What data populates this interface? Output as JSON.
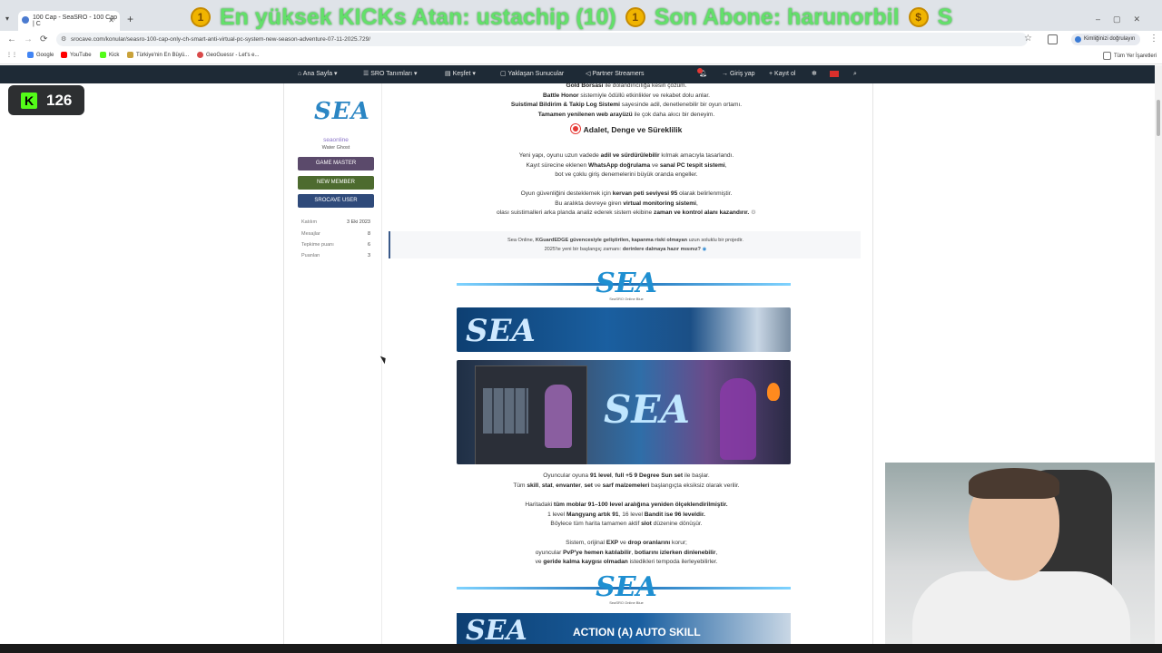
{
  "browser": {
    "tab_title": "100 Cap - SeaSRO - 100 Cap | C",
    "marquee_1": "En yüksek KICKs Atan: ustachip (10)",
    "marquee_2": "Son Abone: harunorbil",
    "marquee_3": "S",
    "url": "srocave.com/konular/seasro-100-cap-only-ch-smart-anti-virtual-pc-system-new-season-adventure-07-11-2025.729/",
    "profile_label": "Kimliğinizi doğrulayın",
    "bookmarks": [
      "Google",
      "YouTube",
      "Kick",
      "Türkiye'nin En Büyü...",
      "GeoGuessr - Let's e..."
    ],
    "all_bookmarks": "Tüm Yer İşaretleri"
  },
  "site_nav": {
    "home": "Ana Sayfa",
    "sro": "SRO Tanımları",
    "explore": "Keşfet",
    "upcoming": "Yaklaşan Sunucular",
    "partners": "Partner Streamers",
    "login": "Giriş yap",
    "register": "Kayıt ol"
  },
  "user_card": {
    "logo": "SEA",
    "username": "seaonline",
    "title": "Water Ghost",
    "badges": [
      "GAME MASTER",
      "NEW MEMBER",
      "SROCAVE USER"
    ],
    "stats": [
      {
        "label": "Katılım",
        "value": "3 Eki 2023"
      },
      {
        "label": "Mesajlar",
        "value": "8"
      },
      {
        "label": "Tepkime puanı",
        "value": "6"
      },
      {
        "label": "Puanları",
        "value": "3"
      }
    ]
  },
  "post": {
    "top_line_1_b": "Gold Borsası",
    "top_line_1": " ile dolandırıcılığa kesin çözüm.",
    "top_line_2_b": "Battle Honor",
    "top_line_2": " sistemiyle ödüllü etkinlikler ve rekabet dolu anlar.",
    "top_line_3_b": "Suistimal Bildirim & Takip Log Sistemi",
    "top_line_3": " sayesinde adil, denetlenebilir bir oyun ortamı.",
    "top_line_4_b": "Tamamen yenilenen web arayüzü",
    "top_line_4": " ile çok daha akıcı bir deneyim.",
    "heading": "Adalet, Denge ve Süreklilik",
    "p1_a": "Yeni yapı, oyunu uzun vadede ",
    "p1_b": "adil ve sürdürülebilir",
    "p1_c": " kılmak amacıyla tasarlandı.",
    "p2_a": "Kayıt sürecine eklenen ",
    "p2_b": "WhatsApp doğrulama",
    "p2_c": " ve ",
    "p2_d": "sanal PC tespit sistemi",
    "p2_e": ",",
    "p3": "bot ve çoklu giriş denemelerini büyük oranda engeller.",
    "p4_a": "Oyun güvenliğini desteklemek için ",
    "p4_b": "kervan peti seviyesi 95",
    "p4_c": " olarak belirlenmiştir.",
    "p5_a": "Bu aralıkta devreye giren ",
    "p5_b": "virtual monitoring sistemi",
    "p5_c": ",",
    "p6_a": "olası suistimalleri arka planda analiz ederek sistem ekibine ",
    "p6_b": "zaman ve kontrol alanı kazandırır.",
    "quote_a": "Sea Online, ",
    "quote_b": "KGuardEDGE güvencesiyle geliştirilen, kapanma riski olmayan",
    "quote_c": " uzun soluklu bir projedir.",
    "quote_d": "2025'te yeni bir başlangıç zamanı: ",
    "quote_e": "derinlere dalmaya hazır mısınız?",
    "banner_logo": "SEA",
    "banner_sub": "SeaSRO Online Blue",
    "p7_a": "Oyuncular oyuna ",
    "p7_b": "91 level",
    "p7_c": ", ",
    "p7_d": "full +5 9 Degree Sun set",
    "p7_e": " ile başlar.",
    "p8_a": "Tüm ",
    "p8_b": "skill",
    "p8_c": ", ",
    "p8_d": "stat",
    "p8_e": ", ",
    "p8_f": "envanter",
    "p8_g": ", ",
    "p8_h": "set",
    "p8_i": " ve ",
    "p8_j": "sarf malzemeleri",
    "p8_k": " başlangıçta eksiksiz olarak verilir.",
    "p9_a": "Haritadaki ",
    "p9_b": "tüm moblar 91–100 level aralığına yeniden ölçeklendirilmiştir.",
    "p10_a": "1 level ",
    "p10_b": "Mangyang artık 91",
    "p10_c": ", 16 level ",
    "p10_d": "Bandit ise 96 leveldir.",
    "p11_a": "Böylece tüm harita tamamen aktif ",
    "p11_b": "slot",
    "p11_c": " düzenine dönüşür.",
    "p12_a": "Sistem, orijinal ",
    "p12_b": "EXP",
    "p12_c": " ve ",
    "p12_d": "drop oranlarını",
    "p12_e": " korur;",
    "p13_a": "oyuncular ",
    "p13_b": "PvP'ye hemen katılabilir",
    "p13_c": ", ",
    "p13_d": "botlarını izlerken dinlenebilir",
    "p13_e": ",",
    "p14_a": "ve ",
    "p14_b": "geride kalma kaygısı olmadan",
    "p14_c": " istedikleri tempoda ilerleyebilirler.",
    "img3_text": "ACTION (A) AUTO SKILL"
  },
  "kick_counter": "126"
}
